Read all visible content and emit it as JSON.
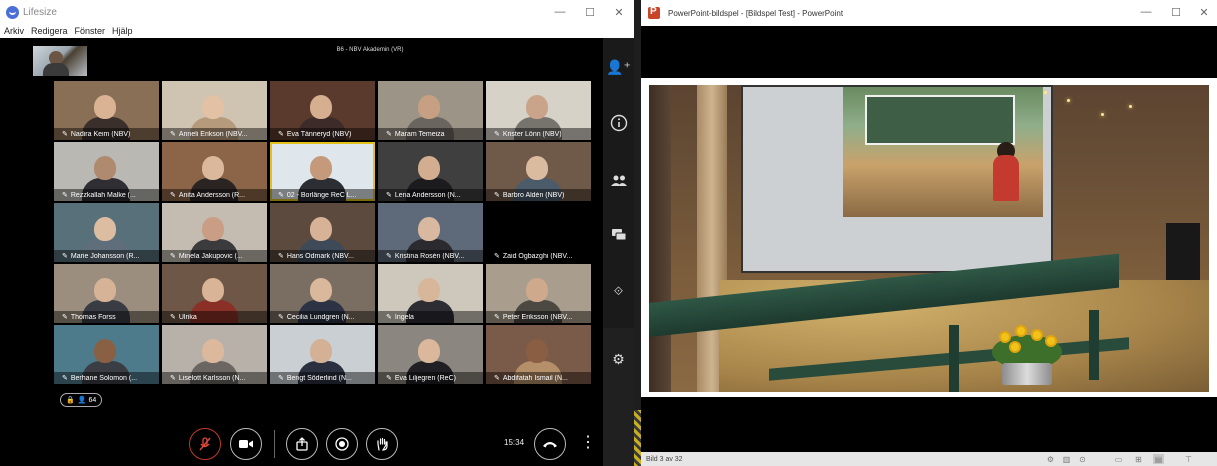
{
  "lifesize": {
    "app_title": "Lifesize",
    "menu": [
      "Arkiv",
      "Redigera",
      "Fönster",
      "Hjälp"
    ],
    "meeting_title": "B6 - NBV Akademin (VR)",
    "participants": [
      {
        "name": "Nadira Keim (NBV)",
        "bg": "#8a6f57",
        "face": "#d9b394",
        "torso": "#3a2f2a"
      },
      {
        "name": "Anneli Erikson (NBV...",
        "bg": "#cfc3b2",
        "face": "#e2c1a4",
        "torso": "#b69a7c"
      },
      {
        "name": "Eva Tånneryd (NBV)",
        "bg": "#5a3a2c",
        "face": "#d6ae90",
        "torso": "#3c2b28"
      },
      {
        "name": "Maram Temeiza",
        "bg": "#9d9488",
        "face": "#c79f83",
        "torso": "#6b6560"
      },
      {
        "name": "Krister Lönn (NBV)",
        "bg": "#d7d2c8",
        "face": "#caa48a",
        "torso": "#77746e"
      },
      {
        "name": "Rezzkallah Malke (...",
        "bg": "#b9b8b3",
        "face": "#b08a6e",
        "torso": "#2e2e33"
      },
      {
        "name": "Anita Andersson (R...",
        "bg": "#8c6448",
        "face": "#dbb89c",
        "torso": "#2a2523"
      },
      {
        "name": "02 - Borlänge ReC L...",
        "bg": "#dfe6ec",
        "face": "#c49a7b",
        "torso": "#2b2e33"
      },
      {
        "name": "Lena Andersson (N...",
        "bg": "#3f3f40",
        "face": "#d2ad8f",
        "torso": "#1c1c1f"
      },
      {
        "name": "Barbro Aldén (NBV)",
        "bg": "#6f5948",
        "face": "#dbbba0",
        "torso": "#4c5b6a"
      },
      {
        "name": "Marie Johansson (R...",
        "bg": "#57707a",
        "face": "#ddbda1",
        "torso": "#5f6e7a"
      },
      {
        "name": "Minela Jakupovic (...",
        "bg": "#c4bcb1",
        "face": "#c99e84",
        "torso": "#3b3a3d"
      },
      {
        "name": "Hans Ödmark (NBV...",
        "bg": "#5c4a3e",
        "face": "#d7b296",
        "torso": "#3f4a58"
      },
      {
        "name": "Kristina Rosén (NBV...",
        "bg": "#5e6a79",
        "face": "#d8b9a0",
        "torso": "#2b2a2f"
      },
      {
        "name": "Zaid Ogbazghi (NBV...",
        "bg": "#000000",
        "face": "#000000",
        "torso": "#000000"
      },
      {
        "name": "Thomas Forss",
        "bg": "#9c8e7f",
        "face": "#d6b397",
        "torso": "#3a3c44"
      },
      {
        "name": "Ulrika",
        "bg": "#6e5746",
        "face": "#d9b497",
        "torso": "#8a3027"
      },
      {
        "name": "Cecilia Lundgren (N...",
        "bg": "#7a6e62",
        "face": "#d9b89c",
        "torso": "#2c3344"
      },
      {
        "name": "Ingela",
        "bg": "#cec8bc",
        "face": "#d8b69a",
        "torso": "#2d2d33"
      },
      {
        "name": "Peter Eriksson (NBV...",
        "bg": "#a99d8d",
        "face": "#cfa98c",
        "torso": "#4c4842"
      },
      {
        "name": "Berhane Solomon (...",
        "bg": "#4d7b8c",
        "face": "#8a6045",
        "torso": "#3a3d44"
      },
      {
        "name": "Liselott Karlsson (N...",
        "bg": "#b7b1a9",
        "face": "#dcb99d",
        "torso": "#6b6661"
      },
      {
        "name": "Bengt Söderlind (N...",
        "bg": "#c9cfd3",
        "face": "#d4b094",
        "torso": "#2a3040"
      },
      {
        "name": "Eva Liljegren (ReC)",
        "bg": "#8b867f",
        "face": "#dbb89b",
        "torso": "#1f1f24"
      },
      {
        "name": "Abdifatah Ismail (N...",
        "bg": "#7a5a49",
        "face": "#8a5e43",
        "torso": "#b58f6a"
      }
    ],
    "active_tile_index": 7,
    "participant_count": "64",
    "time": "15:34",
    "accent_mute": "#c0392b",
    "active_outline": "#e2c21a"
  },
  "powerpoint": {
    "window_title": "PowerPoint-bildspel - [Bildspel Test] - PowerPoint",
    "slide_status": "Bild 3 av 32"
  }
}
